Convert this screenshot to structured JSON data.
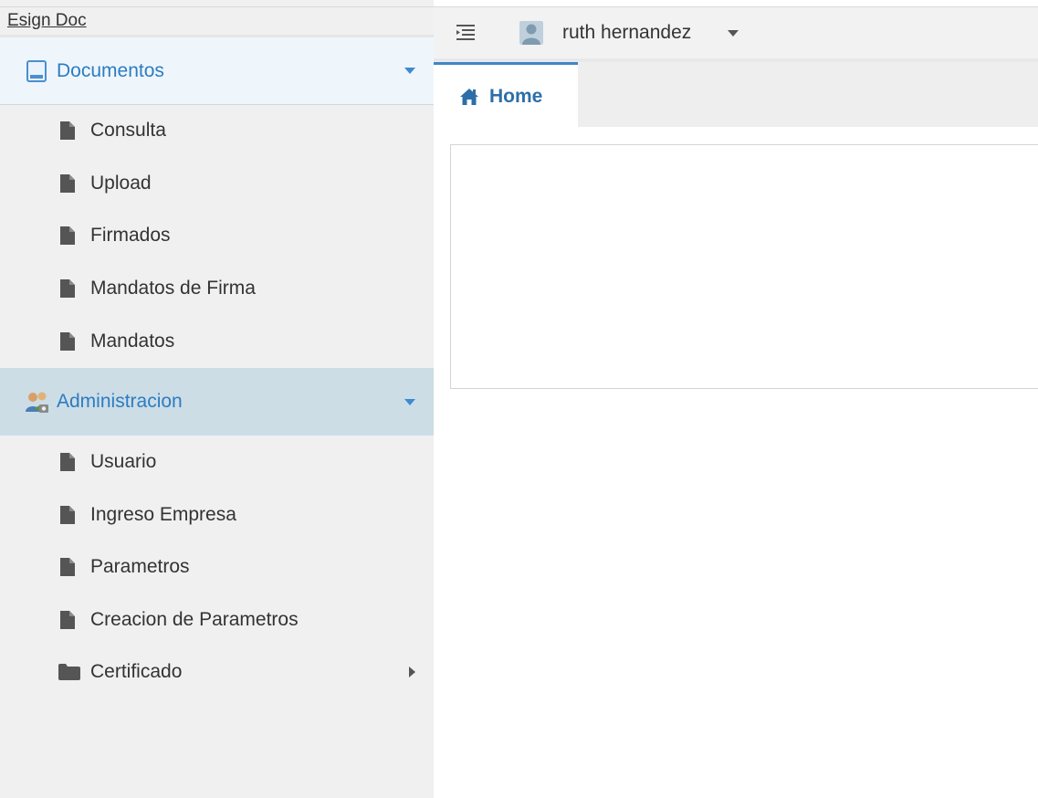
{
  "app": {
    "brand": "Esign Doc"
  },
  "header": {
    "user_name": "ruth hernandez"
  },
  "sidebar": {
    "sections": [
      {
        "label": "Documentos",
        "items": [
          {
            "label": "Consulta"
          },
          {
            "label": "Upload"
          },
          {
            "label": "Firmados"
          },
          {
            "label": "Mandatos de Firma"
          },
          {
            "label": "Mandatos"
          }
        ]
      },
      {
        "label": "Administracion",
        "items": [
          {
            "label": "Usuario"
          },
          {
            "label": "Ingreso Empresa"
          },
          {
            "label": "Parametros"
          },
          {
            "label": "Creacion de Parametros"
          },
          {
            "label": "Certificado"
          }
        ]
      }
    ]
  },
  "tabs": [
    {
      "label": "Home",
      "active": true
    }
  ],
  "icons": {
    "menu_toggle": "menu-toggle-icon",
    "avatar": "user-avatar-icon",
    "home": "home-icon",
    "documents_section": "document-icon",
    "admin_section": "admin-users-icon",
    "item": "file-icon",
    "folder": "folder-icon"
  },
  "colors": {
    "accent": "#2d7cc1",
    "sidebar_bg": "#f0f0f0",
    "docs_header_bg": "#eef6fc",
    "admin_header_bg": "#ccdde6",
    "tab_active_border": "#3d86c8"
  }
}
